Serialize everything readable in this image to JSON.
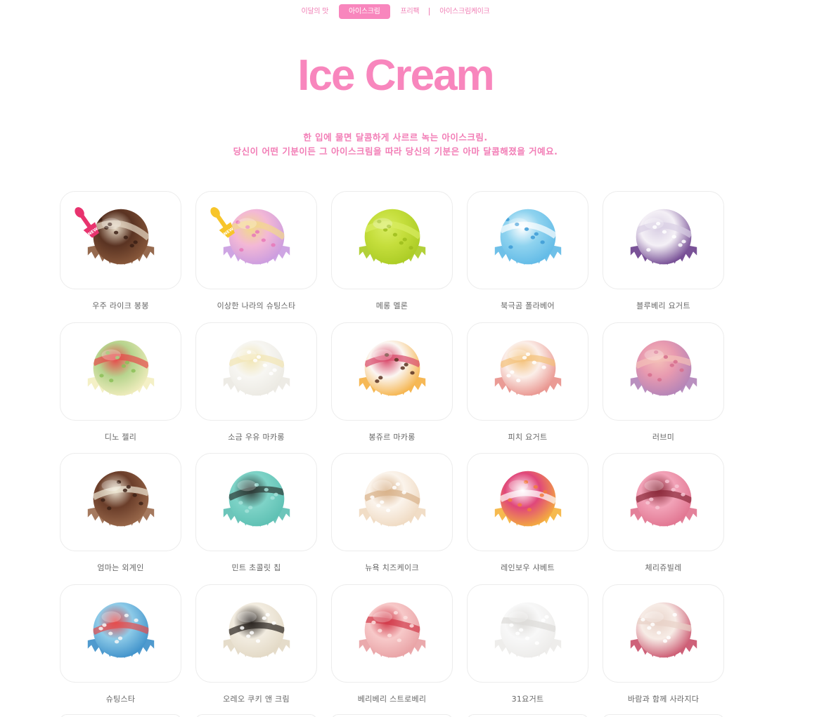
{
  "nav": {
    "items": [
      {
        "label": "이달의 맛",
        "active": false
      },
      {
        "label": "아이스크림",
        "active": true
      },
      {
        "label": "프리팩",
        "active": false
      },
      {
        "label": "아이스크림케이크",
        "active": false
      }
    ]
  },
  "page_title": "Ice Cream",
  "description": {
    "line1": "한 입에 물면 달콤하게 사르르 녹는 아이스크림.",
    "line2": "당신이 어떤 기분이든 그 아이스크림을 따라 당신의 기분은 아마 달콤해졌을 거예요."
  },
  "badge_text": "NEW",
  "products": [
    {
      "name": "우주 라이크 봉봉",
      "badge": "new-pink",
      "colors": [
        "#5a3322",
        "#8b5a3c",
        "#e8dcc8",
        "#3b2015"
      ]
    },
    {
      "name": "이상한 나라의 슈팅스타",
      "badge": "new-yellow",
      "colors": [
        "#f3b8d6",
        "#c99be0",
        "#f2d98a",
        "#e878b8"
      ]
    },
    {
      "name": "메롱 멜론",
      "badge": "",
      "colors": [
        "#c5de3c",
        "#aacb24",
        "#d8ec62",
        "#9dbd1c"
      ]
    },
    {
      "name": "북극곰 폴라베어",
      "badge": "",
      "colors": [
        "#8fd3ef",
        "#5fb9e6",
        "#ffffff",
        "#3d9bd6"
      ]
    },
    {
      "name": "블루베리 요거트",
      "badge": "",
      "colors": [
        "#f4f0f6",
        "#6a3f8c",
        "#d9cfe4",
        "#ffffff"
      ]
    },
    {
      "name": "디노 젤리",
      "badge": "",
      "colors": [
        "#b7d48e",
        "#f3eec0",
        "#e64c4c",
        "#8cc058"
      ]
    },
    {
      "name": "소금 우유 마카롱",
      "badge": "",
      "colors": [
        "#f7f6f2",
        "#ebe9e2",
        "#f2e6b4",
        "#ffffff"
      ]
    },
    {
      "name": "봉쥬르 마카롱",
      "badge": "",
      "colors": [
        "#fbf6f2",
        "#f5b042",
        "#d94a6b",
        "#5a3322"
      ]
    },
    {
      "name": "피치 요거트",
      "badge": "",
      "colors": [
        "#fbeee8",
        "#e8908a",
        "#f4c27a",
        "#ffffff"
      ]
    },
    {
      "name": "러브미",
      "badge": "",
      "colors": [
        "#e89ab0",
        "#b183b8",
        "#f4c0b8",
        "#d66f8e"
      ]
    },
    {
      "name": "엄마는 외계인",
      "badge": "",
      "colors": [
        "#6b3e2a",
        "#9b6a4c",
        "#f0e8d6",
        "#3d2216"
      ]
    },
    {
      "name": "민트 초콜릿 칩",
      "badge": "",
      "colors": [
        "#7ed3c7",
        "#5cbfb2",
        "#2e3a36",
        "#a5e2d9"
      ]
    },
    {
      "name": "뉴욕 치즈케이크",
      "badge": "",
      "colors": [
        "#fbf4ec",
        "#efd9c0",
        "#d9b28a",
        "#ffffff"
      ]
    },
    {
      "name": "레인보우 샤베트",
      "badge": "",
      "colors": [
        "#e0477a",
        "#f5b23c",
        "#ffffff",
        "#f27d3c"
      ]
    },
    {
      "name": "체리쥬빌레",
      "badge": "",
      "colors": [
        "#f2a3b8",
        "#e0738f",
        "#8b2a3a",
        "#f7c6d3"
      ]
    },
    {
      "name": "슈팅스타",
      "badge": "",
      "colors": [
        "#8ecbe8",
        "#3c8fc9",
        "#e64c4c",
        "#f7f7f7"
      ]
    },
    {
      "name": "오레오 쿠키 앤 크림",
      "badge": "",
      "colors": [
        "#f2ece0",
        "#e2d8c4",
        "#2a2420",
        "#ffffff"
      ]
    },
    {
      "name": "베리베리 스트로베리",
      "badge": "",
      "colors": [
        "#f7c9c9",
        "#e8a0a3",
        "#d23a4a",
        "#fbe1df"
      ]
    },
    {
      "name": "31요거트",
      "badge": "",
      "colors": [
        "#f8f8f8",
        "#ecebe9",
        "#dddbd8",
        "#ffffff"
      ]
    },
    {
      "name": "바람과 함께 사라지다",
      "badge": "",
      "colors": [
        "#f7ece6",
        "#c9506a",
        "#e8d2c8",
        "#ffffff"
      ]
    }
  ]
}
